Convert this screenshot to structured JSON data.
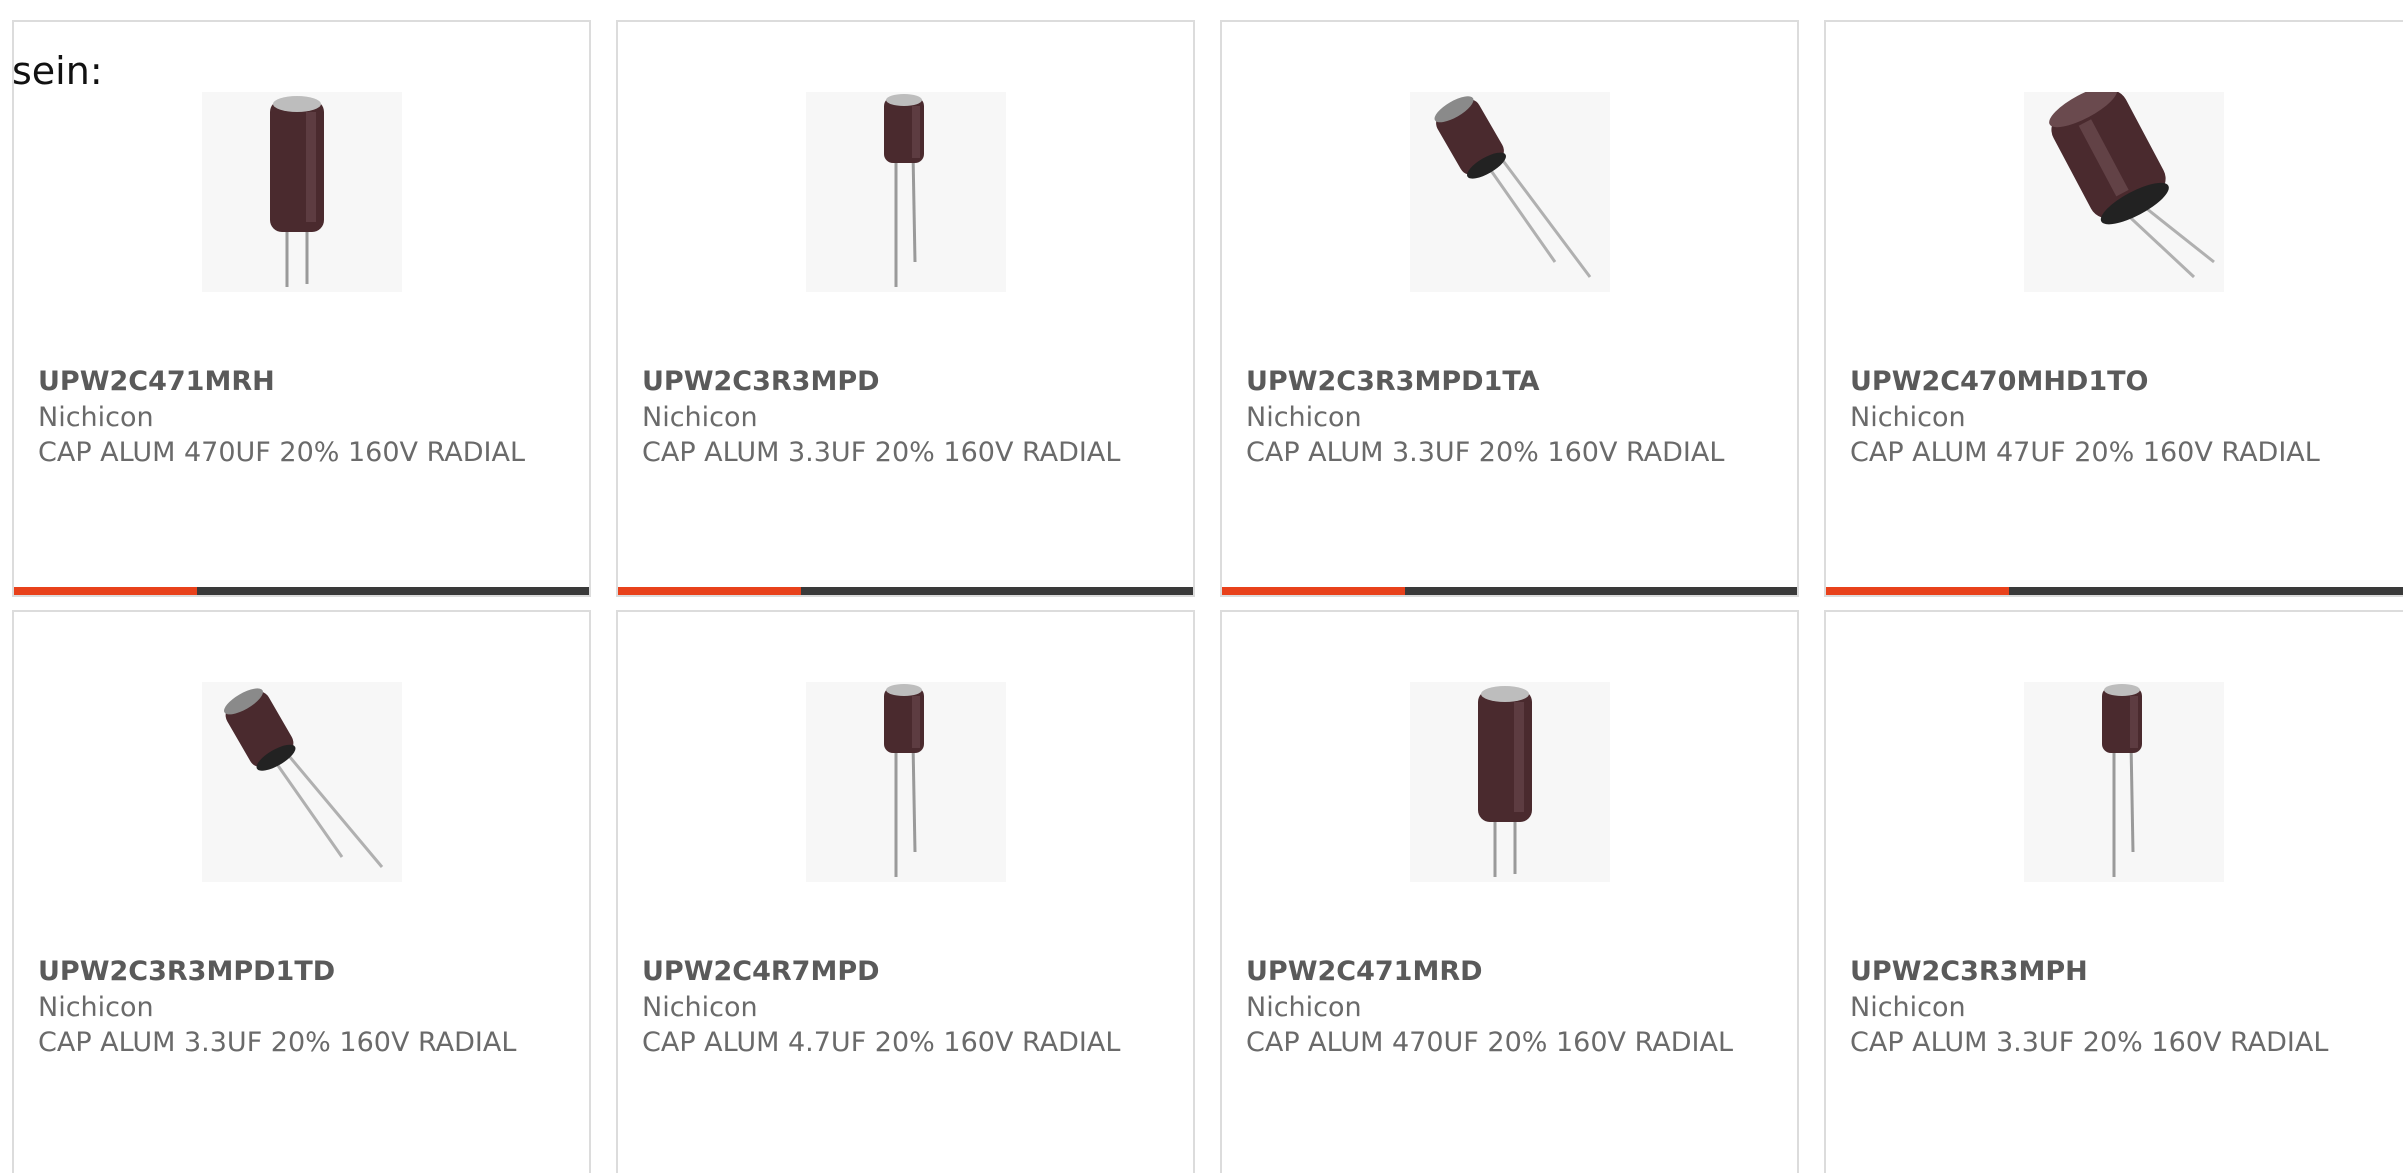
{
  "intro": "sein:",
  "colors": {
    "accent": "#e8411b",
    "bar_dark": "#3a3a3a",
    "capacitor_body": "#4a2a2e"
  },
  "products": [
    {
      "part": "UPW2C471MRH",
      "maker": "Nichicon",
      "desc": "CAP ALUM 470UF 20% 160V RADIAL",
      "image_icon": "capacitor-tall-upright"
    },
    {
      "part": "UPW2C3R3MPD",
      "maker": "Nichicon",
      "desc": "CAP ALUM 3.3UF 20% 160V RADIAL",
      "image_icon": "capacitor-small-upright"
    },
    {
      "part": "UPW2C3R3MPD1TA",
      "maker": "Nichicon",
      "desc": "CAP ALUM 3.3UF 20% 160V RADIAL",
      "image_icon": "capacitor-small-tilted"
    },
    {
      "part": "UPW2C470MHD1TO",
      "maker": "Nichicon",
      "desc": "CAP ALUM 47UF 20% 160V RADIAL",
      "image_icon": "capacitor-large-tilted"
    },
    {
      "part": "UPW2C3R3MPD1TD",
      "maker": "Nichicon",
      "desc": "CAP ALUM 3.3UF 20% 160V RADIAL",
      "image_icon": "capacitor-small-tilted"
    },
    {
      "part": "UPW2C4R7MPD",
      "maker": "Nichicon",
      "desc": "CAP ALUM 4.7UF 20% 160V RADIAL",
      "image_icon": "capacitor-small-upright"
    },
    {
      "part": "UPW2C471MRD",
      "maker": "Nichicon",
      "desc": "CAP ALUM 470UF 20% 160V RADIAL",
      "image_icon": "capacitor-tall-upright"
    },
    {
      "part": "UPW2C3R3MPH",
      "maker": "Nichicon",
      "desc": "CAP ALUM 3.3UF 20% 160V RADIAL",
      "image_icon": "capacitor-small-upright"
    }
  ]
}
